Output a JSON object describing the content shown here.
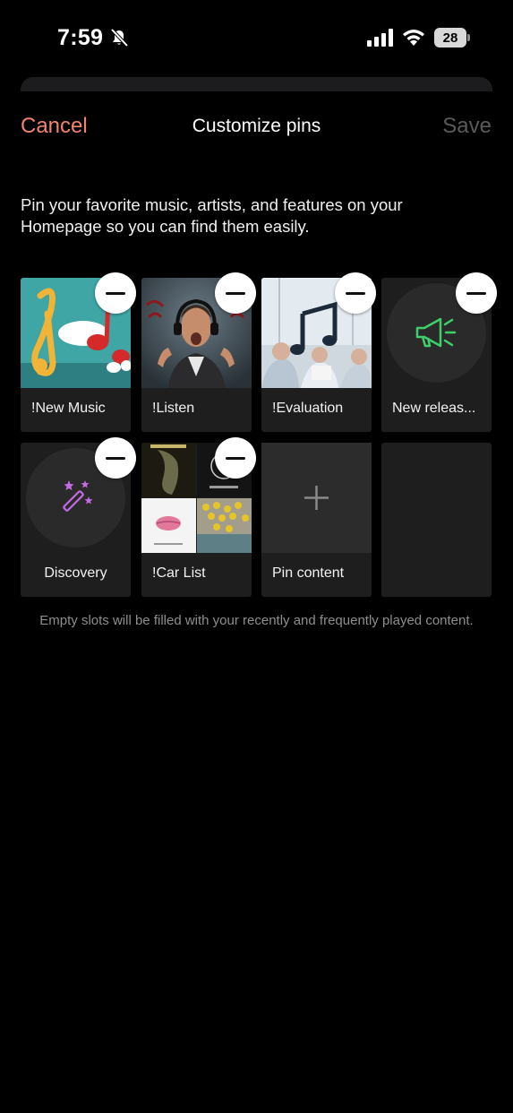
{
  "status_bar": {
    "time": "7:59",
    "battery_level": "28",
    "icons": [
      "bell-slash-icon",
      "signal-icon",
      "wifi-icon",
      "battery-icon"
    ]
  },
  "nav": {
    "cancel_label": "Cancel",
    "title": "Customize pins",
    "save_label": "Save"
  },
  "intro_text": "Pin your favorite music, artists, and features on your Homepage so you can find them easily.",
  "pins": [
    {
      "label": "!New Music",
      "art": "music-notes-cartoon"
    },
    {
      "label": "!Listen",
      "art": "man-with-headphones"
    },
    {
      "label": "!Evaluation",
      "art": "music-note-meeting"
    },
    {
      "label": "New releas...",
      "art": "megaphone-icon"
    },
    {
      "label": "Discovery",
      "art": "magic-wand-icon"
    },
    {
      "label": "!Car List",
      "art": "album-collage"
    }
  ],
  "add_slot": {
    "label": "Pin content",
    "icon": "plus-icon"
  },
  "footer_note": "Empty slots will be filled with your recently and frequently played content.",
  "colors": {
    "accent_cancel": "#f2836c",
    "save_disabled": "#5a5a5a",
    "megaphone": "#3ecf6a",
    "wand": "#c46ae6"
  }
}
